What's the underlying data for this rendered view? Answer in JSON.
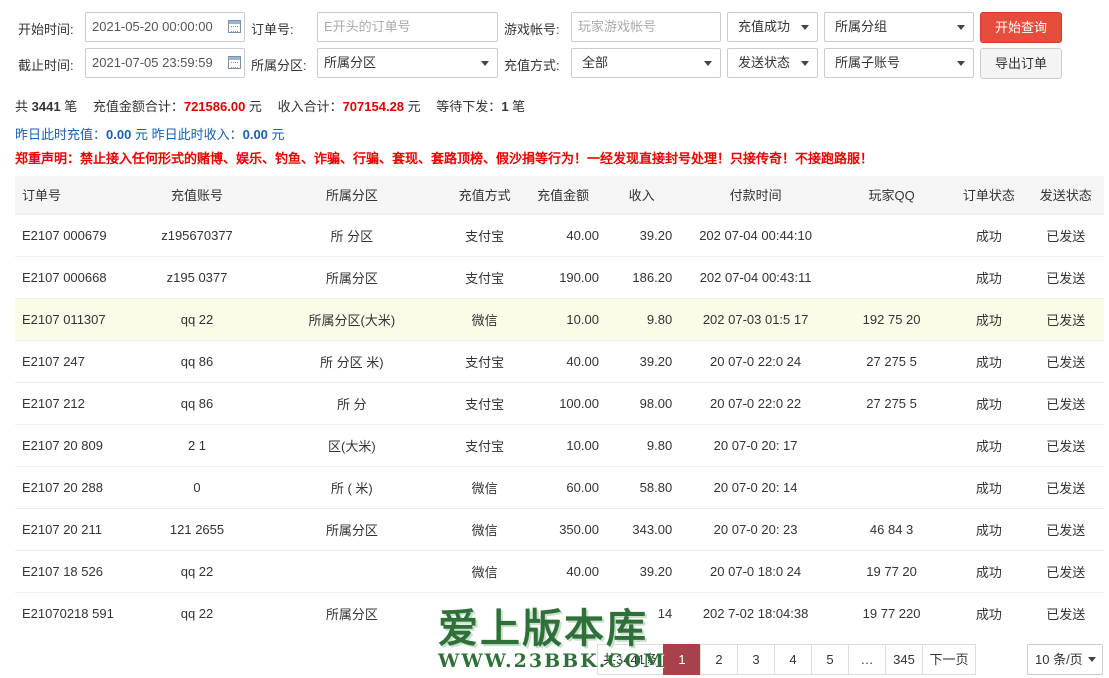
{
  "filters": {
    "start_time": {
      "label": "开始时间:",
      "value": "2021-05-20 00:00:00"
    },
    "end_time": {
      "label": "截止时间:",
      "value": "2021-07-05 23:59:59"
    },
    "order_no": {
      "label": "订单号:",
      "placeholder": "E开头的订单号"
    },
    "game_account": {
      "label": "游戏帐号:",
      "placeholder": "玩家游戏帐号"
    },
    "region": {
      "label": "所属分区:",
      "value": "所属分区"
    },
    "pay_method": {
      "label": "充值方式:",
      "value": "全部"
    },
    "pay_status": {
      "value": "充值成功"
    },
    "group": {
      "value": "所属分组"
    },
    "send_status": {
      "value": "发送状态"
    },
    "sub_account": {
      "value": "所属子账号"
    },
    "search_button": "开始查询",
    "export_button": "导出订单"
  },
  "summary": {
    "total_prefix": "共",
    "total_count": "3441",
    "total_suffix": "笔",
    "recharge_label": "充值金额合计：",
    "recharge_value": "721586.00",
    "income_label": "收入合计：",
    "income_value": "707154.28",
    "unit": "元",
    "pending_label": "等待下发：",
    "pending_value": "1",
    "pending_unit": "笔"
  },
  "yesterday": {
    "recharge_label": "昨日此时充值：",
    "recharge_value": "0.00",
    "income_label": "昨日此时收入：",
    "income_value": "0.00",
    "unit": "元"
  },
  "notice": "郑重声明：禁止接入任何形式的赌博、娱乐、钓鱼、诈骗、行骗、套现、套路顶榜、假沙捐等行为！一经发现直接封号处理！只接传奇！不接跑路服！",
  "table": {
    "headers": [
      "订单号",
      "充值账号",
      "所属分区",
      "充值方式",
      "充值金额",
      "收入",
      "付款时间",
      "玩家QQ",
      "订单状态",
      "发送状态"
    ],
    "rows": [
      {
        "order": "E2107  000679",
        "account": "z195670377",
        "region": "所  分区",
        "method": "支付宝",
        "amount": "40.00",
        "income": "39.20",
        "time": "202  07-04 00:44:10",
        "qq": "",
        "status": "成功",
        "send": "已发送"
      },
      {
        "order": "E2107   000668",
        "account": "z195  0377",
        "region": "所属分区",
        "method": "支付宝",
        "amount": "190.00",
        "income": "186.20",
        "time": "202  07-04 00:43:11",
        "qq": "",
        "status": "成功",
        "send": "已发送"
      },
      {
        "order": "E2107  011307",
        "account": "qq   22",
        "region": "所属分区(大米)",
        "method": "微信",
        "amount": "10.00",
        "income": "9.80",
        "time": "202  07-03 01:5  17",
        "qq": "192  75  20",
        "status": "成功",
        "send": "已发送"
      },
      {
        "order": "E2107   247",
        "account": "qq  86",
        "region": "所  分区   米)",
        "method": "支付宝",
        "amount": "40.00",
        "income": "39.20",
        "time": "20   07-0  22:0  24",
        "qq": "27  275  5",
        "status": "成功",
        "send": "已发送"
      },
      {
        "order": "E2107   212",
        "account": "qq  86",
        "region": "所  分",
        "method": "支付宝",
        "amount": "100.00",
        "income": "98.00",
        "time": "20   07-0  22:0  22",
        "qq": "27  275  5",
        "status": "成功",
        "send": "已发送"
      },
      {
        "order": "E2107  20  809",
        "account": "2  1",
        "region": "区(大米)",
        "method": "支付宝",
        "amount": "10.00",
        "income": "9.80",
        "time": "20   07-0  20:  17",
        "qq": "",
        "status": "成功",
        "send": "已发送"
      },
      {
        "order": "E2107  20  288",
        "account": "  0",
        "region": "所   (  米)",
        "method": "微信",
        "amount": "60.00",
        "income": "58.80",
        "time": "20   07-0  20:  14",
        "qq": "",
        "status": "成功",
        "send": "已发送"
      },
      {
        "order": "E2107  20  211",
        "account": "121  2655",
        "region": "所属分区",
        "method": "微信",
        "amount": "350.00",
        "income": "343.00",
        "time": "20   07-0  20:  23",
        "qq": "46  84  3",
        "status": "成功",
        "send": "已发送"
      },
      {
        "order": "E2107  18  526",
        "account": "qq  22",
        "region": "",
        "method": "微信",
        "amount": "40.00",
        "income": "39.20",
        "time": "20   07-0  18:0  24",
        "qq": "19  77  20",
        "status": "成功",
        "send": "已发送"
      },
      {
        "order": "E21070218  591",
        "account": "qq  22",
        "region": "所属分区",
        "method": "",
        "amount": "",
        "income": "14",
        "time": "202  7-02 18:04:38",
        "qq": "19  77  220",
        "status": "成功",
        "send": "已发送"
      }
    ]
  },
  "pagination": {
    "total_label": "共3441条",
    "pages": [
      "1",
      "2",
      "3",
      "4",
      "5",
      "…",
      "345"
    ],
    "next": "下一页",
    "page_size": "10 条/页"
  },
  "watermark": {
    "main": "爱上版本库",
    "sub": "WWW.23BBK.COM"
  }
}
